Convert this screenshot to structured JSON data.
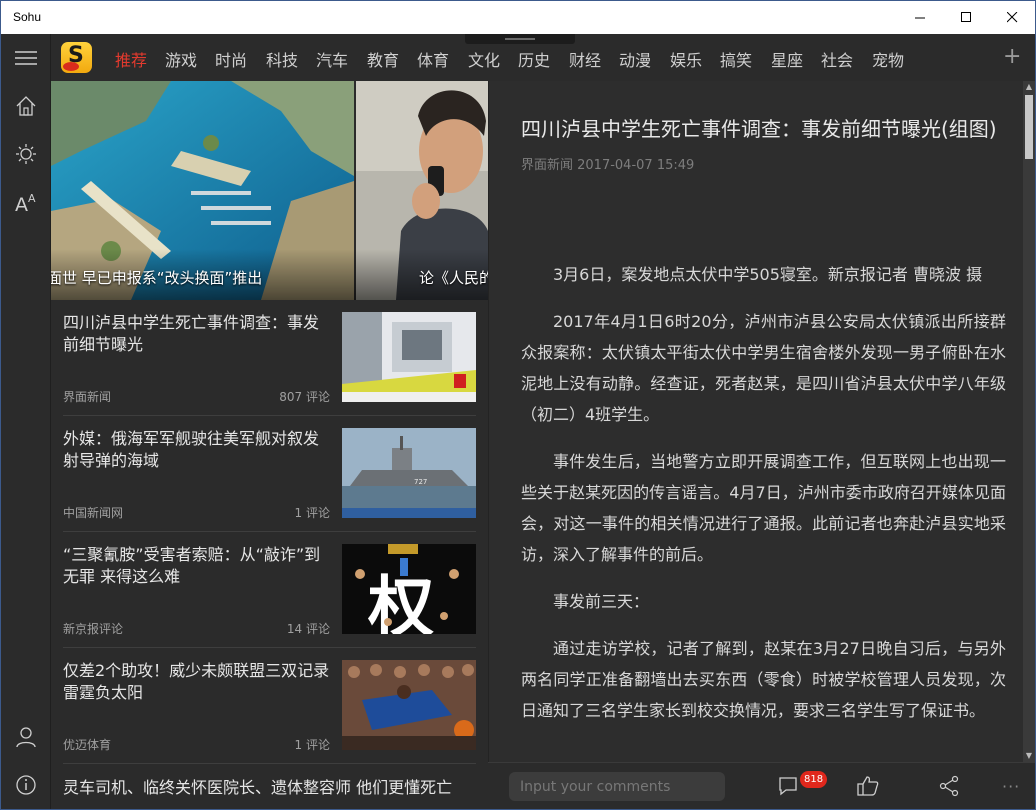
{
  "window": {
    "title": "Sohu"
  },
  "rail": {
    "items": [
      {
        "name": "hamburger-menu-icon"
      },
      {
        "name": "home-icon"
      },
      {
        "name": "brightness-icon"
      },
      {
        "name": "font-size-icon"
      },
      {
        "name": "user-icon"
      },
      {
        "name": "info-icon"
      }
    ]
  },
  "channels": {
    "items": [
      "推荐",
      "游戏",
      "时尚",
      "科技",
      "汽车",
      "教育",
      "体育",
      "文化",
      "历史",
      "财经",
      "动漫",
      "娱乐",
      "搞笑",
      "星座",
      "社会",
      "宠物"
    ],
    "active_index": 0,
    "add_label": "+"
  },
  "hero": {
    "slides": [
      {
        "caption": "面世 早已申报系“改头换面”推出"
      },
      {
        "caption": "论《人民的"
      }
    ]
  },
  "news": {
    "items": [
      {
        "title": "四川泸县中学生死亡事件调查：事发前细节曝光",
        "source": "界面新闻",
        "comments": "807 评论",
        "thumb": "dormitory-photo"
      },
      {
        "title": "外媒：俄海军军舰驶往美军舰对叙发射导弹的海域",
        "source": "中国新闻网",
        "comments": "1 评论",
        "thumb": "warship-photo"
      },
      {
        "title": "“三聚氰胺”受害者索赔：从“敲诈”到无罪 来得这么难",
        "source": "新京报评论",
        "comments": "14 评论",
        "thumb": "rights-poster"
      },
      {
        "title": "仅差2个助攻！威少未颇联盟三双记录 雷霆负太阳",
        "source": "优迈体育",
        "comments": "1 评论",
        "thumb": "basketball-photo"
      }
    ],
    "last_title": "灵车司机、临终关怀医院长、遗体整容师 他们更懂死亡"
  },
  "article": {
    "title": "四川泸县中学生死亡事件调查：事发前细节曝光(组图)",
    "meta": "界面新闻 2017-04-07 15:49",
    "paragraphs": [
      "3月6日，案发地点太伏中学505寝室。新京报记者 曹晓波 摄",
      "2017年4月1日6时20分，泸州市泸县公安局太伏镇派出所接群众报案称：太伏镇太平街太伏中学男生宿舍楼外发现一男子俯卧在水泥地上没有动静。经查证，死者赵某，是四川省泸县太伏中学八年级（初二）4班学生。",
      "事件发生后，当地警方立即开展调查工作，但互联网上也出现一些关于赵某死因的传言谣言。4月7日，泸州市委市政府召开媒体见面会，对这一事件的相关情况进行了通报。此前记者也奔赴泸县实地采访，深入了解事件的前后。",
      "事发前三天：",
      "通过走访学校，记者了解到，赵某在3月27日晚自习后，与另外两名同学正准备翻墙出去买东西（零食）时被学校管理人员发现，次日通知了三名学生家长到校交换情况，要求三名学生写了保证书。"
    ]
  },
  "bottombar": {
    "comment_placeholder": "Input your comments",
    "comment_count": "818",
    "more_label": "···"
  },
  "colors": {
    "accent": "#e23a2e",
    "background": "#2b2b2b",
    "badge": "#e0271c"
  }
}
